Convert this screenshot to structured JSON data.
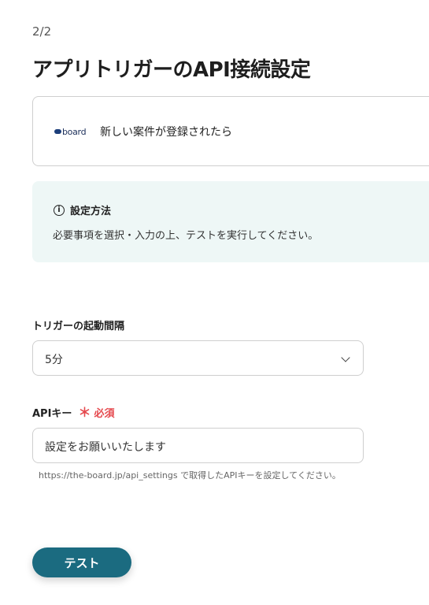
{
  "page": {
    "step": "2/2",
    "title": "アプリトリガーのAPI接続設定"
  },
  "app": {
    "logo_text": "board",
    "trigger_label": "新しい案件が登録されたら"
  },
  "info": {
    "title": "設定方法",
    "body": "必要事項を選択・入力の上、テストを実行してください。"
  },
  "form": {
    "interval": {
      "label": "トリガーの起動間隔",
      "value": "5分"
    },
    "api_key": {
      "label": "APIキー",
      "required_mark": "＊",
      "required_text": "必須",
      "value": "設定をお願いいたします",
      "help": "https://the-board.jp/api_settings で取得したAPIキーを設定してください。"
    }
  },
  "actions": {
    "test_label": "テスト"
  },
  "colors": {
    "accent": "#1b6b80",
    "info_bg": "#eef7f6",
    "required": "#e5484d"
  }
}
